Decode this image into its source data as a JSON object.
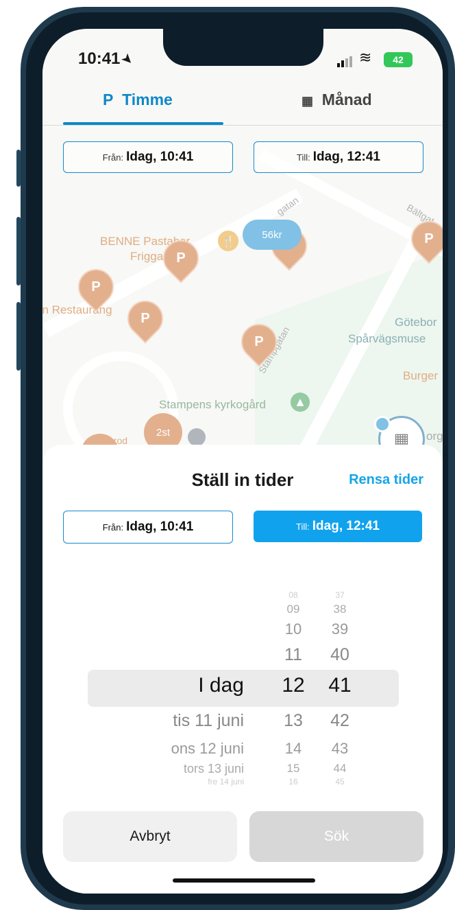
{
  "status_bar": {
    "time": "10:41",
    "battery": "42"
  },
  "tabs": {
    "hour": "Timme",
    "hour_prefix": "P",
    "month": "Månad"
  },
  "top_range": {
    "from_label": "Från:",
    "from_value": "Idag, 10:41",
    "to_label": "Till:",
    "to_value": "Idag, 12:41"
  },
  "map": {
    "labels": {
      "pastabar": "BENNE Pastabar",
      "friggagatan": "Friggagatan",
      "restaurant": "on Restaurang",
      "kyrkogard": "Stampens kyrkogård",
      "stampgatan": "Stampgatan",
      "baltgatan": "Bältgat",
      "gotebor": "Götebor",
      "sparvags": "Spårvägsmuse",
      "burger": "Burger",
      "org": "org",
      "gatan": "gatan",
      "prod": "prod"
    },
    "price_badge": "56kr",
    "cluster_badge": "2st",
    "pin_letter": "P"
  },
  "sheet": {
    "title": "Ställ in tider",
    "reset": "Rensa tider",
    "from_label": "Från:",
    "from_value": "Idag, 10:41",
    "to_label": "Till:",
    "to_value": "Idag, 12:41"
  },
  "picker": {
    "days": [
      "I dag",
      "tis 11 juni",
      "ons 12 juni",
      "tors 13 juni",
      "fre 14 juni"
    ],
    "hours": [
      "08",
      "09",
      "10",
      "11",
      "12",
      "13",
      "14",
      "15",
      "16"
    ],
    "minutes": [
      "37",
      "38",
      "39",
      "40",
      "41",
      "42",
      "43",
      "44",
      "45"
    ]
  },
  "footer": {
    "cancel": "Avbryt",
    "search": "Sök"
  },
  "colors": {
    "accent": "#11a2ee",
    "tab_active": "#0f87c9",
    "pin": "#cc6f32"
  }
}
